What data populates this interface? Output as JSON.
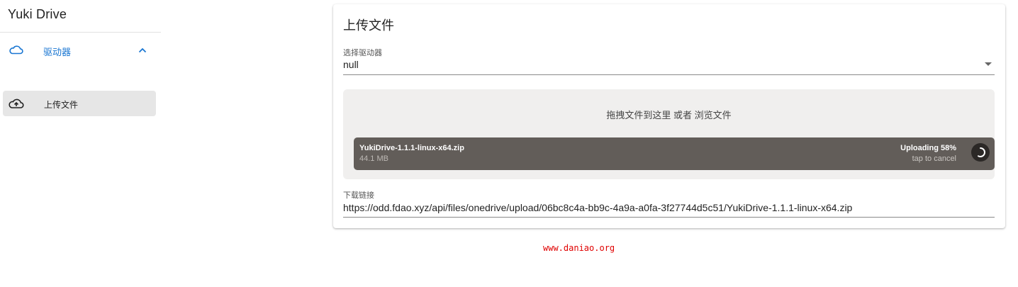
{
  "app": {
    "title": "Yuki Drive"
  },
  "sidebar": {
    "group": {
      "label": "驱动器",
      "icon": "cloud-icon",
      "expanded_icon": "chevron-up-icon"
    },
    "items": [
      {
        "label": "上传文件",
        "icon": "cloud-upload-icon",
        "active": true
      }
    ]
  },
  "main": {
    "title": "上传文件",
    "drive_select": {
      "label": "选择驱动器",
      "value": "null",
      "icon": "dropdown-arrow-icon"
    },
    "dropzone": {
      "text": "拖拽文件到这里 或者",
      "browse_label": "浏览文件",
      "file": {
        "name": "YukiDrive-1.1.1-linux-x64.zip",
        "size": "44.1 MB",
        "status": "Uploading 58%",
        "progress": 0.58,
        "cancel_hint": "tap to cancel"
      }
    },
    "download_link": {
      "label": "下载链接",
      "value": "https://odd.fdao.xyz/api/files/onedrive/upload/06bc8c4a-bb9c-4a9a-a0fa-3f27744d5c51/YukiDrive-1.1.1-linux-x64.zip"
    }
  },
  "watermark": "www.daniao.org",
  "colors": {
    "accent": "#1976d2",
    "file_panel": "#625d59",
    "dropzone_bg": "#f0efee",
    "watermark": "#e00000"
  }
}
